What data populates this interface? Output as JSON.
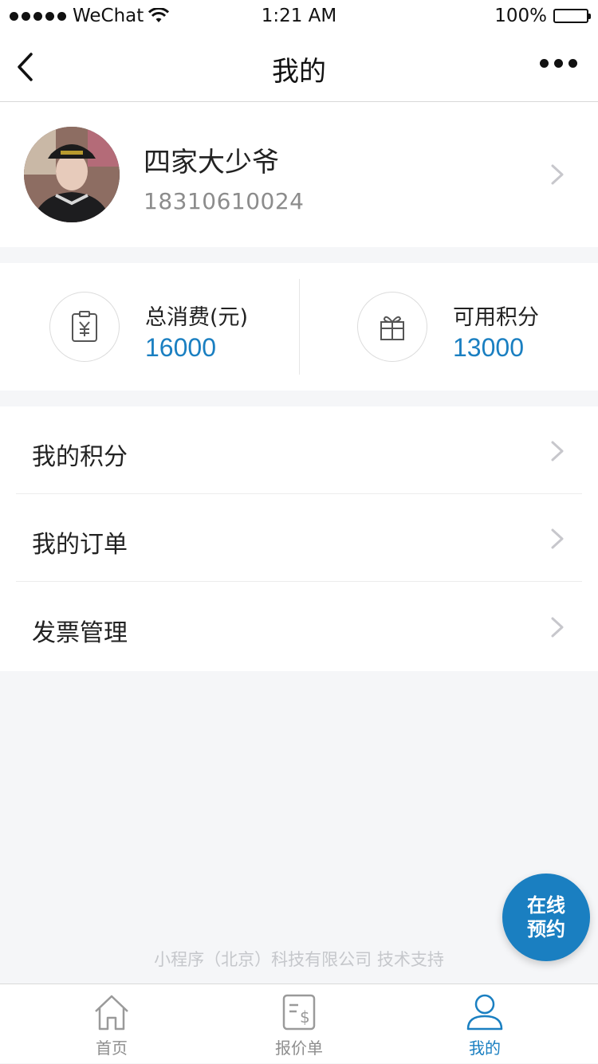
{
  "status_bar": {
    "carrier": "WeChat",
    "time": "1:21 AM",
    "battery": "100%"
  },
  "nav": {
    "title": "我的"
  },
  "profile": {
    "name": "四家大少爷",
    "phone": "18310610024"
  },
  "stats": [
    {
      "label": "总消费(元)",
      "value": "16000",
      "icon": "yuan-receipt-icon"
    },
    {
      "label": "可用积分",
      "value": "13000",
      "icon": "gift-icon"
    }
  ],
  "menu": [
    {
      "label": "我的积分"
    },
    {
      "label": "我的订单"
    },
    {
      "label": "发票管理"
    }
  ],
  "footer": {
    "credit": "小程序（北京）科技有限公司 技术支持"
  },
  "fab": {
    "line1": "在线",
    "line2": "预约"
  },
  "tabbar": [
    {
      "label": "首页",
      "icon": "home-icon",
      "active": false
    },
    {
      "label": "报价单",
      "icon": "quote-icon",
      "active": false
    },
    {
      "label": "我的",
      "icon": "user-icon",
      "active": true
    }
  ],
  "colors": {
    "accent": "#1a7fc1",
    "background": "#f5f6f8"
  }
}
